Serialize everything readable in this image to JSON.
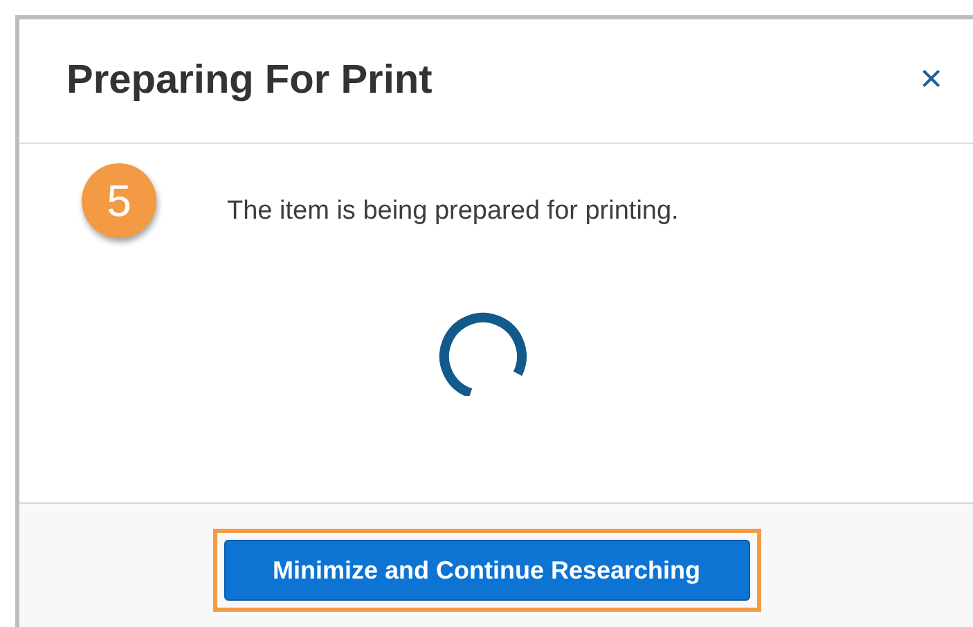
{
  "dialog": {
    "title": "Preparing For Print",
    "close": "×"
  },
  "step_badge": "5",
  "message": "The item is being prepared for printing.",
  "footer": {
    "button": {
      "label": "Minimize and Continue Researching",
      "highlighted": true
    }
  }
}
